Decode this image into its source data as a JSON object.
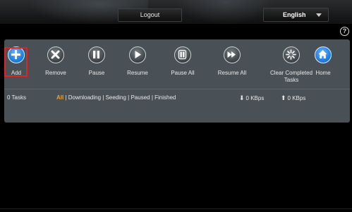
{
  "header": {
    "logout_label": "Logout",
    "language": "English"
  },
  "help_glyph": "?",
  "toolbar": {
    "items": [
      {
        "label": "Add",
        "icon": "plus-icon"
      },
      {
        "label": "Remove",
        "icon": "x-icon"
      },
      {
        "label": "Pause",
        "icon": "pause-icon"
      },
      {
        "label": "Resume",
        "icon": "play-icon"
      },
      {
        "label": "Pause All",
        "icon": "pause-all-icon"
      },
      {
        "label": "Resume All",
        "icon": "fast-forward-icon"
      },
      {
        "label": "Clear Completed Tasks",
        "icon": "clear-icon"
      },
      {
        "label": "Home",
        "icon": "home-icon"
      }
    ],
    "highlighted": "Add"
  },
  "status": {
    "task_count": "0 Tasks",
    "filters": {
      "all": "All",
      "sep": " | ",
      "downloading": "Downloading",
      "seeding": "Seeding",
      "paused": "Paused",
      "finished": "Finished"
    },
    "download_speed": "0 KBps",
    "upload_speed": "0 KBps"
  },
  "colors": {
    "accent_active_filter": "#f0a020",
    "highlight_border": "#e02424",
    "primary_blue": "#1f7fe0"
  }
}
